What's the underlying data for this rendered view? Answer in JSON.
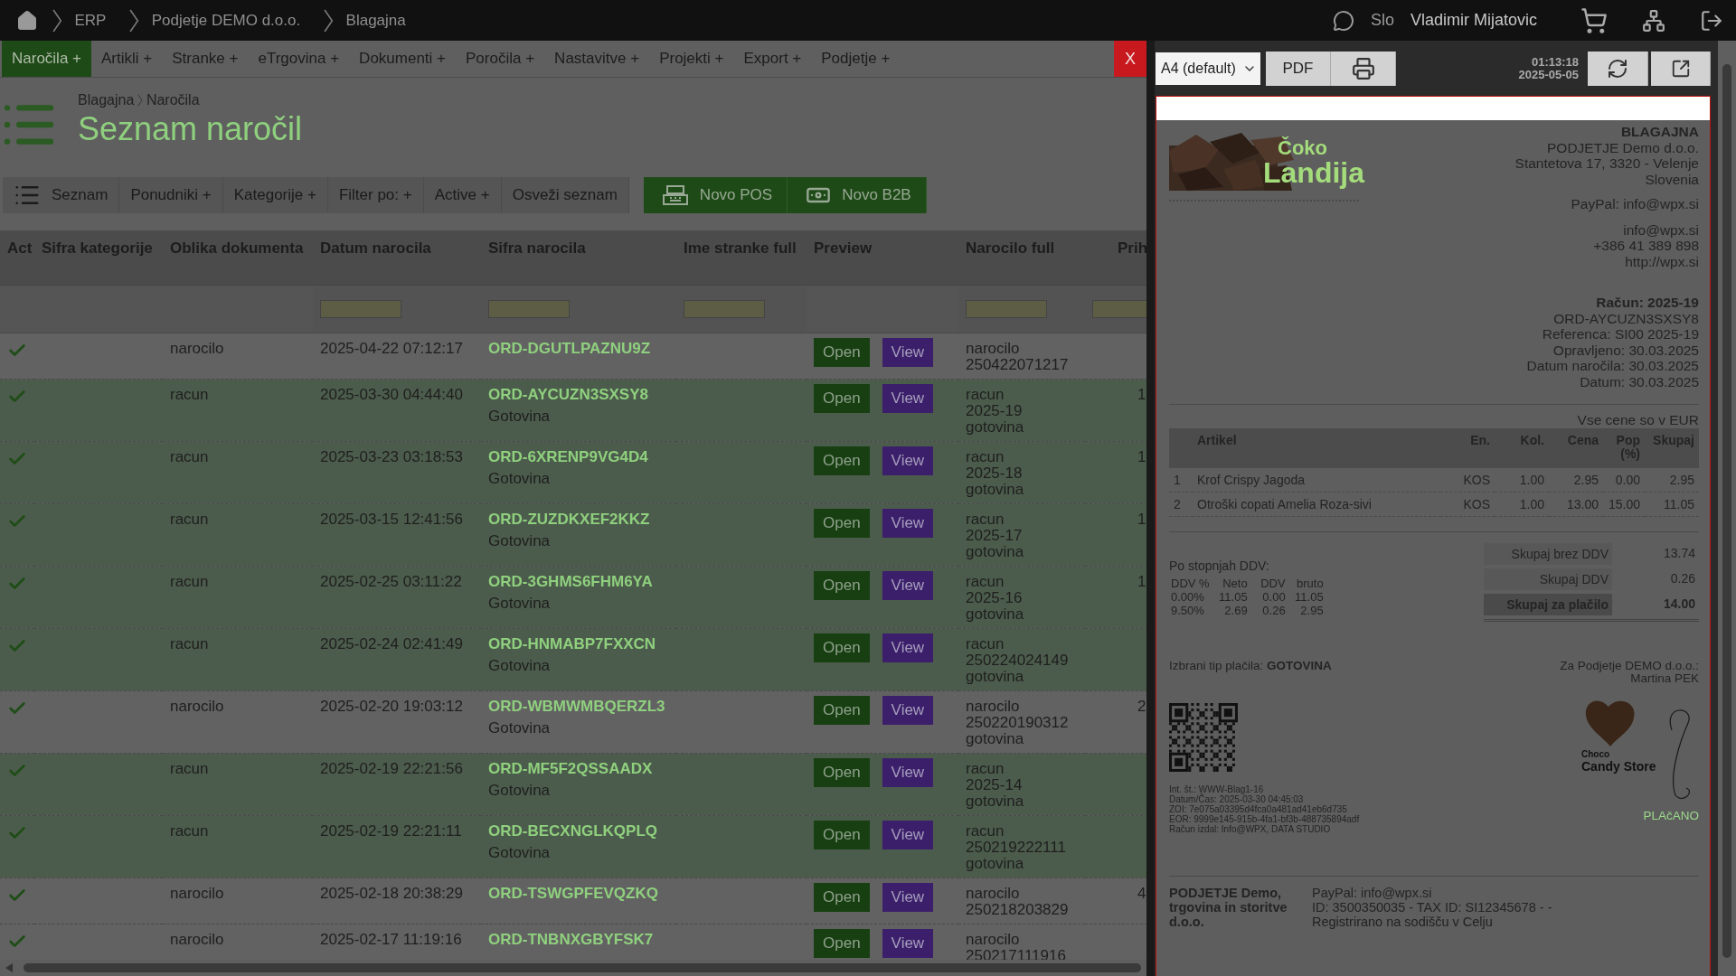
{
  "topbar": {
    "breadcrumbs": [
      "ERP",
      "Podjetje DEMO d.o.o.",
      "Blagajna"
    ],
    "language": "Slo",
    "user": "Vladimir Mijatovic"
  },
  "menu": [
    {
      "label": "Naročila +",
      "selected": true
    },
    {
      "label": "Artikli +",
      "selected": false
    },
    {
      "label": "Stranke +",
      "selected": false
    },
    {
      "label": "eTrgovina +",
      "selected": false
    },
    {
      "label": "Dokumenti +",
      "selected": false
    },
    {
      "label": "Poročila +",
      "selected": false
    },
    {
      "label": "Nastavitve +",
      "selected": false
    },
    {
      "label": "Projekti +",
      "selected": false
    },
    {
      "label": "Export +",
      "selected": false
    },
    {
      "label": "Podjetje +",
      "selected": false
    }
  ],
  "page": {
    "breadcrumbs": [
      "Blagajna",
      "Naročila"
    ],
    "title": "Seznam naročil"
  },
  "toolbar": {
    "items": [
      "Seznam",
      "Ponudniki +",
      "Kategorije +",
      "Filter po: +",
      "Active +",
      "Osveži seznam"
    ],
    "actions": [
      "Novo POS",
      "Novo B2B"
    ]
  },
  "table": {
    "columns": [
      {
        "label": "Act",
        "filter": false
      },
      {
        "label": "Sifra kategorije",
        "filter": false
      },
      {
        "label": "Oblika dokumenta",
        "filter": false
      },
      {
        "label": "Datum narocila",
        "filter": true
      },
      {
        "label": "Sifra narocila",
        "filter": true
      },
      {
        "label": "Ime stranke full",
        "filter": true
      },
      {
        "label": "Preview",
        "filter": false
      },
      {
        "label": "Narocilo full",
        "filter": true
      },
      {
        "label": "Prih",
        "filter": true
      }
    ],
    "rows": [
      {
        "active": true,
        "highlighted": false,
        "type": "narocilo",
        "date": "2025-04-22 07:12:17",
        "code": "ORD-DGUTLPAZNU9Z",
        "actions": [
          "Open",
          "View"
        ],
        "full": [
          "narocilo",
          "250422071217"
        ]
      },
      {
        "active": true,
        "highlighted": true,
        "type": "racun",
        "date": "2025-03-30 04:44:40",
        "code": "ORD-AYCUZN3SXSY8",
        "payment": "Gotovina",
        "actions": [
          "Open",
          "View"
        ],
        "full": [
          "racun",
          "2025-19",
          "gotovina"
        ],
        "prih": "1"
      },
      {
        "active": true,
        "highlighted": true,
        "type": "racun",
        "date": "2025-03-23 03:18:53",
        "code": "ORD-6XRENP9VG4D4",
        "payment": "Gotovina",
        "actions": [
          "Open",
          "View"
        ],
        "full": [
          "racun",
          "2025-18",
          "gotovina"
        ],
        "prih": "1"
      },
      {
        "active": true,
        "highlighted": true,
        "type": "racun",
        "date": "2025-03-15 12:41:56",
        "code": "ORD-ZUZDKXEF2KKZ",
        "payment": "Gotovina",
        "actions": [
          "Open",
          "View"
        ],
        "full": [
          "racun",
          "2025-17",
          "gotovina"
        ],
        "prih": "1"
      },
      {
        "active": true,
        "highlighted": true,
        "type": "racun",
        "date": "2025-02-25 03:11:22",
        "code": "ORD-3GHMS6FHM6YA",
        "payment": "Gotovina",
        "actions": [
          "Open",
          "View"
        ],
        "full": [
          "racun",
          "2025-16",
          "gotovina"
        ],
        "prih": "1"
      },
      {
        "active": true,
        "highlighted": true,
        "type": "racun",
        "date": "2025-02-24 02:41:49",
        "code": "ORD-HNMABP7FXXCN",
        "payment": "Gotovina",
        "actions": [
          "Open",
          "View"
        ],
        "full": [
          "racun",
          "250224024149",
          "gotovina"
        ]
      },
      {
        "active": true,
        "highlighted": false,
        "type": "narocilo",
        "date": "2025-02-20 19:03:12",
        "code": "ORD-WBMWMBQERZL3",
        "payment": "Gotovina",
        "actions": [
          "Open",
          "View"
        ],
        "full": [
          "narocilo",
          "250220190312",
          "gotovina"
        ],
        "prih": "2"
      },
      {
        "active": true,
        "highlighted": true,
        "type": "racun",
        "date": "2025-02-19 22:21:56",
        "code": "ORD-MF5F2QSSAADX",
        "payment": "Gotovina",
        "actions": [
          "Open",
          "View"
        ],
        "full": [
          "racun",
          "2025-14",
          "gotovina"
        ]
      },
      {
        "active": true,
        "highlighted": true,
        "type": "racun",
        "date": "2025-02-19 22:21:11",
        "code": "ORD-BECXNGLKQPLQ",
        "payment": "Gotovina",
        "actions": [
          "Open",
          "View"
        ],
        "full": [
          "racun",
          "250219222111",
          "gotovina"
        ]
      },
      {
        "active": true,
        "highlighted": false,
        "type": "narocilo",
        "date": "2025-02-18 20:38:29",
        "code": "ORD-TSWGPFEVQZKQ",
        "actions": [
          "Open",
          "View"
        ],
        "full": [
          "narocilo",
          "250218203829"
        ],
        "prih": "4"
      },
      {
        "active": true,
        "highlighted": false,
        "type": "narocilo",
        "date": "2025-02-17 11:19:16",
        "code": "ORD-TNBNXGBYFSK7",
        "actions": [
          "Open",
          "View"
        ],
        "full": [
          "narocilo",
          "250217111916"
        ]
      }
    ]
  },
  "preview": {
    "close": "X",
    "format": "A4 (default)",
    "pdf": "PDF",
    "time": "01:13:18",
    "date": "2025-05-05",
    "document": {
      "logo": [
        "Čoko",
        "Landija"
      ],
      "issuer": {
        "heading": "BLAGAJNA",
        "lines": [
          "PODJETJE Demo d.o.o.",
          "Stantetova 17, 3320 - Velenje",
          "Slovenia"
        ]
      },
      "paypal": "PayPal: info@wpx.si",
      "contacts": [
        "info@wpx.si",
        "+386 41 389 898",
        "http://wpx.si"
      ],
      "invoice": {
        "heading": "Račun: 2025-19",
        "lines": [
          "ORD-AYCUZN3SXSY8",
          "Referenca: SI00 2025-19",
          "Opravljeno: 30.03.2025",
          "Datum naročila: 30.03.2025",
          "Datum: 30.03.2025"
        ]
      },
      "currency_note": "Vse cene so v EUR",
      "items": {
        "columns": [
          "",
          "Artikel",
          "En.",
          "Kol.",
          "Cena",
          "Pop (%)",
          "Skupaj"
        ],
        "rows": [
          [
            "1",
            "Krof Crispy Jagoda",
            "KOS",
            "1.00",
            "2.95",
            "0.00",
            "2.95"
          ],
          [
            "2",
            "Otroški copati Amelia Roza-sivi",
            "KOS",
            "1.00",
            "13.00",
            "15.00",
            "11.05"
          ]
        ]
      },
      "vat": {
        "title": "Po stopnjah DDV:",
        "columns": [
          "DDV %",
          "Neto",
          "DDV",
          "bruto"
        ],
        "rows": [
          [
            "0.00%",
            "11.05",
            "0.00",
            "11.05"
          ],
          [
            "9.50%",
            "2.69",
            "0.26",
            "2.95"
          ]
        ]
      },
      "totals": [
        {
          "label": "Skupaj brez DDV",
          "value": "13.74",
          "grand": false
        },
        {
          "label": "Skupaj DDV",
          "value": "0.26",
          "grand": false
        },
        {
          "label": "Skupaj za plačilo",
          "value": "14.00",
          "grand": true
        }
      ],
      "payment": "Izbrani tip plačila: **GOTOVINA**",
      "signatory": [
        "Za Podjetje DEMO d.o.o.:",
        "Martina PEK"
      ],
      "stamp": [
        "Choco",
        "Candy Store"
      ],
      "status": "PLAčANO",
      "fiscal": [
        "Int. št.: WWW-Blag1-16",
        "Datum/Čas: 2025-03-30 04:45:03",
        "ZOI: 7e075a03395d4fca0a481ad41eb6d735",
        "EOR: 9999e145-915b-4fa1-bf3b-488735894adf",
        "Račun izdal: Info@WPX, DATA STUDIO"
      ],
      "footer": {
        "company": "PODJETJE Demo, trgovina in storitve d.o.o.",
        "lines": [
          "PayPal: info@wpx.si",
          "ID: 3500350035 - TAX ID: SI12345678 - -"
        ],
        "note": "Registrirano na sodišču v Celju"
      }
    }
  }
}
